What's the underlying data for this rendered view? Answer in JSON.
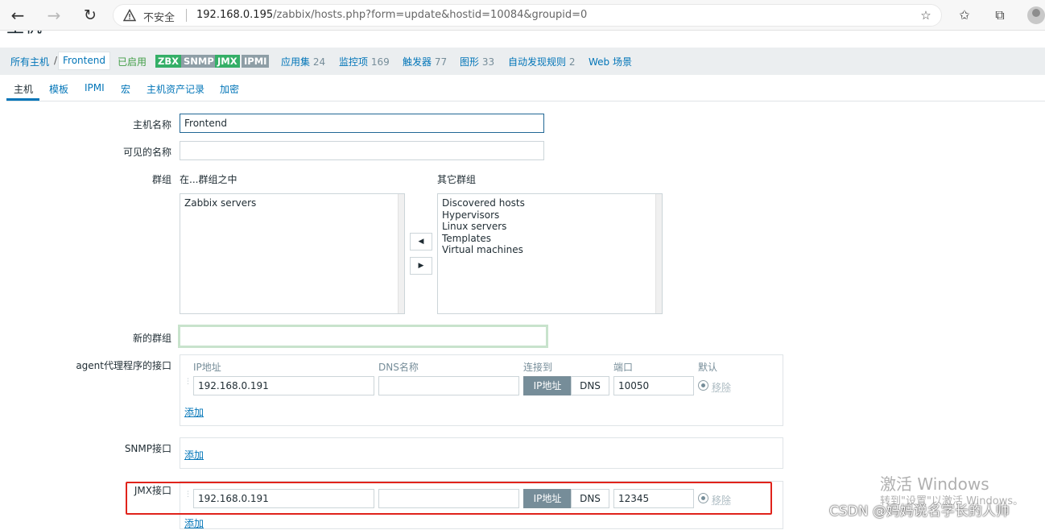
{
  "browser": {
    "security_label": "不安全",
    "url_host": "192.168.0.195",
    "url_path": "/zabbix/hosts.php?form=update&hostid=10084&groupid=0"
  },
  "page": {
    "title": "主机"
  },
  "host_nav": {
    "all_hosts": "所有主机",
    "separator": "/",
    "current_host": "Frontend",
    "status": "已启用",
    "badges": [
      {
        "label": "ZBX",
        "color": "#34af67"
      },
      {
        "label": "SNMP",
        "color": "#8e9ea6"
      },
      {
        "label": "JMX",
        "color": "#34af67"
      },
      {
        "label": "IPMI",
        "color": "#8e9ea6"
      }
    ],
    "links": [
      {
        "label": "应用集",
        "count": "24"
      },
      {
        "label": "监控项",
        "count": "169"
      },
      {
        "label": "触发器",
        "count": "77"
      },
      {
        "label": "图形",
        "count": "33"
      },
      {
        "label": "自动发现规则",
        "count": "2"
      },
      {
        "label": "Web 场景",
        "count": ""
      }
    ]
  },
  "tabs": [
    "主机",
    "模板",
    "IPMI",
    "宏",
    "主机资产记录",
    "加密"
  ],
  "form": {
    "host_name_label": "主机名称",
    "host_name_value": "Frontend",
    "visible_name_label": "可见的名称",
    "visible_name_value": "",
    "groups_label": "群组",
    "in_groups_label": "在...群组之中",
    "other_groups_label": "其它群组",
    "in_groups": [
      "Zabbix servers"
    ],
    "other_groups": [
      "Discovered hosts",
      "Hypervisors",
      "Linux servers",
      "Templates",
      "Virtual machines"
    ],
    "new_group_label": "新的群组",
    "new_group_value": ""
  },
  "interfaces": {
    "columns": {
      "ip": "IP地址",
      "dns": "DNS名称",
      "connect": "连接到",
      "port": "端口",
      "default": "默认"
    },
    "connect_ip": "IP地址",
    "connect_dns": "DNS",
    "remove_label": "移除",
    "add_label": "添加",
    "agent": {
      "label": "agent代理程序的接口",
      "ip": "192.168.0.191",
      "dns": "",
      "port": "10050"
    },
    "snmp": {
      "label": "SNMP接口"
    },
    "jmx": {
      "label": "JMX接口",
      "ip": "192.168.0.191",
      "dns": "",
      "port": "12345"
    }
  },
  "overlays": {
    "activate_title": "激活 Windows",
    "activate_sub": "转到\"设置\"以激活 Windows。",
    "csdn": "CSDN @妈妈说名字长的人帅"
  },
  "colors": {
    "accent": "#0275b8",
    "highlight": "#e0231b",
    "enabled": "#429e47"
  }
}
